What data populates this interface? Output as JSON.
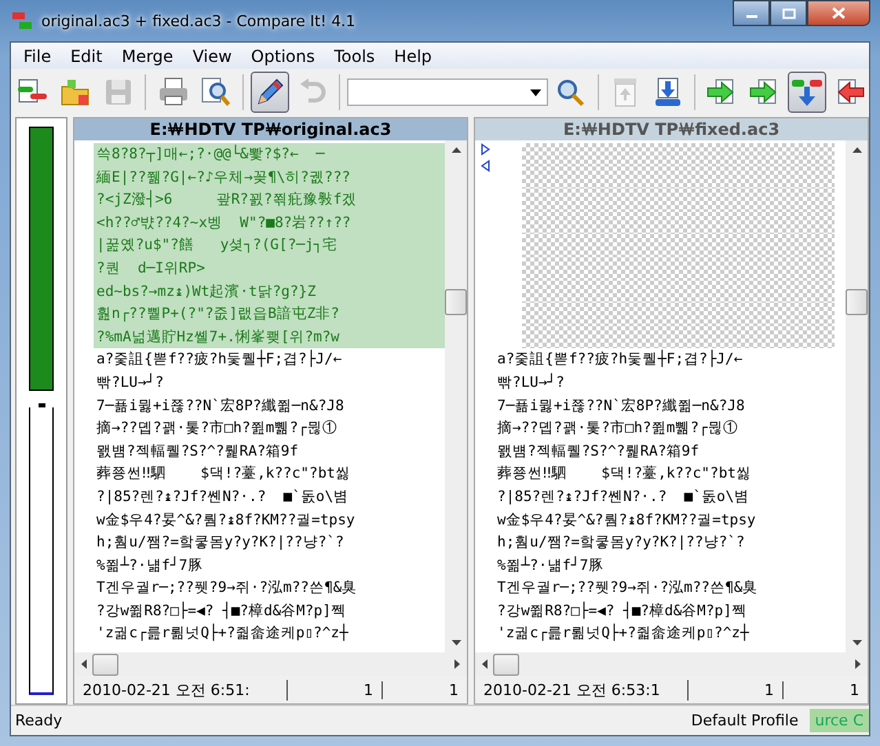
{
  "window": {
    "title": "original.ac3 + fixed.ac3 - Compare It! 4.1"
  },
  "menu": [
    "File",
    "Edit",
    "Merge",
    "View",
    "Options",
    "Tools",
    "Help"
  ],
  "toolbar": [
    {
      "kind": "compare",
      "selected": false,
      "disabled": false
    },
    {
      "kind": "open",
      "selected": false,
      "disabled": false
    },
    {
      "kind": "save",
      "selected": false,
      "disabled": true
    },
    {
      "kind": "sep"
    },
    {
      "kind": "print",
      "selected": false,
      "disabled": false
    },
    {
      "kind": "preview",
      "selected": false,
      "disabled": false
    },
    {
      "kind": "sep"
    },
    {
      "kind": "edit",
      "selected": true,
      "disabled": false
    },
    {
      "kind": "undo",
      "selected": false,
      "disabled": true
    },
    {
      "kind": "sep"
    },
    {
      "kind": "combo"
    },
    {
      "kind": "search",
      "selected": false,
      "disabled": false
    },
    {
      "kind": "sep"
    },
    {
      "kind": "up",
      "selected": false,
      "disabled": true
    },
    {
      "kind": "down",
      "selected": false,
      "disabled": false
    },
    {
      "kind": "sep"
    },
    {
      "kind": "right",
      "selected": false,
      "disabled": false
    },
    {
      "kind": "right",
      "selected": false,
      "disabled": false
    },
    {
      "kind": "merge",
      "selected": true,
      "disabled": false
    },
    {
      "kind": "left",
      "selected": false,
      "disabled": false
    }
  ],
  "left_pane": {
    "path": "E:￦HDTV TP￦original.ac3",
    "active": true,
    "lines": [
      {
        "kind": "changed",
        "text": "쓱8?8?┬]매←;?·@@└&뽳?$?←  ─"
      },
      {
        "kind": "changed",
        "text": "緬E|??쮊?G|←?♪우체→꽂¶\\히?궶???"
      },
      {
        "kind": "changed",
        "text": "?<jZ潑┤>6     괖R?꾌?쬒疪豫斅f겠"
      },
      {
        "kind": "changed",
        "text": "<h??♂뱏??4?~x벵  W\"?■8?岩??↑??"
      },
      {
        "kind": "changed",
        "text": "|꿆옜?u$\"?饍   y셪┐?(G[?─j┐宅"
      },
      {
        "kind": "changed",
        "text": "?퀀  d─I위RP>"
      },
      {
        "kind": "changed",
        "text": "ed~bs?→mz↨)Wt起濱·t닭?g?}Z"
      },
      {
        "kind": "changed",
        "text": "훮n┌??쀁P+(?\"?줎]랪읍B諳屯Z非?"
      },
      {
        "kind": "changed",
        "text": "?%mA넒邁貯Hz쏄7+.悧峯쾢[위?m?w"
      },
      {
        "kind": "same",
        "text": "a?줓詛{뽇f??疲?h둧퀠┼F;겹?├J/←"
      },
      {
        "kind": "same",
        "text": "빢?LU→┘?"
      },
      {
        "kind": "same",
        "text": "7─푦i뮗+i쬲??N`宏8P?纖쮦─n&?J8"
      },
      {
        "kind": "same",
        "text": "摘→??뎹?괡·톷?市□h?쮪m쀎?┌뮎①"
      },
      {
        "kind": "same",
        "text": "뫬뱸?젝輻퀠?S?^?뤭RA?箱9f"
      },
      {
        "kind": "same",
        "text": "葬쭁썬‼駟    $댁!?薹,k??c\"?bt씷"
      },
      {
        "kind": "same",
        "text": "?|85?렌?↨?Jf?쏀N?·.?  ■`돐o\\볌"
      },
      {
        "kind": "same",
        "text": "w金$우4?妟^&?뤔?↨8f?KM??궐=tpsy"
      },
      {
        "kind": "same",
        "text": "h;훰u/쨈?=핰쿻몸y?y?K?|??냥?`?"
      },
      {
        "kind": "same",
        "text": "%쬚┴?·냶f┘7豚"
      },
      {
        "kind": "same",
        "text": "T겐우궐r─;??퓃?9→쥐·?泓m??쓴¶&臭"
      },
      {
        "kind": "same",
        "text": "?강w쮦R8?□├=◀? ┤■?樟d&谷M?p]쩩"
      },
      {
        "kind": "same",
        "text": "'z궒c┌릂r뢺넛Q├+?줣畲途케p▯?^z┼"
      }
    ],
    "footer": {
      "timestamp": "2010-02-21  오전 6:51:",
      "line": "1",
      "column": "1"
    }
  },
  "right_pane": {
    "path": "E:￦HDTV TP￦fixed.ac3",
    "active": false,
    "lines": [
      {
        "kind": "missing"
      },
      {
        "kind": "missing"
      },
      {
        "kind": "missing"
      },
      {
        "kind": "missing"
      },
      {
        "kind": "missing"
      },
      {
        "kind": "missing"
      },
      {
        "kind": "missing"
      },
      {
        "kind": "missing"
      },
      {
        "kind": "missing"
      },
      {
        "kind": "same",
        "text": "a?줓詛{뽇f??疲?h둧퀠┼F;겹?├J/←"
      },
      {
        "kind": "same",
        "text": "빢?LU→┘?"
      },
      {
        "kind": "same",
        "text": "7─푦i뮗+i쬲??N`宏8P?纖쮦─n&?J8"
      },
      {
        "kind": "same",
        "text": "摘→??뎹?괡·톷?市□h?쮪m쀎?┌뮎①"
      },
      {
        "kind": "same",
        "text": "뫬뱸?젝輻퀠?S?^?뤭RA?箱9f"
      },
      {
        "kind": "same",
        "text": "葬쭁썬‼駟    $댁!?薹,k??c\"?bt씷"
      },
      {
        "kind": "same",
        "text": "?|85?렌?↨?Jf?쏀N?·.?  ■`돐o\\볌"
      },
      {
        "kind": "same",
        "text": "w金$우4?妟^&?뤔?↨8f?KM??궐=tpsy"
      },
      {
        "kind": "same",
        "text": "h;훰u/쨈?=핰쿻몸y?y?K?|??냥?`?"
      },
      {
        "kind": "same",
        "text": "%쬚┴?·냶f┘7豚"
      },
      {
        "kind": "same",
        "text": "T겐우궐r─;??퓃?9→쥐·?泓m??쓴¶&臭"
      },
      {
        "kind": "same",
        "text": "?강w쮦R8?□├=◀? ┤■?樟d&谷M?p]쩩"
      },
      {
        "kind": "same",
        "text": "'z궒c┌릂r뢺넛Q├+?줣畲途케p▯?^z┼"
      }
    ],
    "footer": {
      "timestamp": "2010-02-21  오전 6:53:1",
      "line": "1",
      "column": "1"
    }
  },
  "status_bar": {
    "message": "Ready",
    "profile": "Default Profile",
    "indicator": "urce C"
  }
}
